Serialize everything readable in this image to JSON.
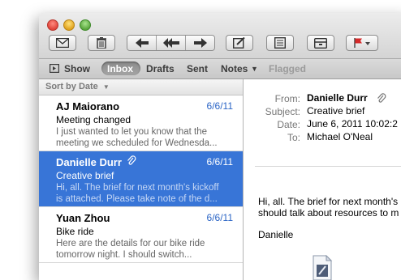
{
  "toolbar": {
    "buttons": [
      "compose-icon",
      "trash-icon",
      "reply-icon",
      "reply-all-icon",
      "forward-icon",
      "new-note-icon",
      "list-icon",
      "archive-icon",
      "flag-icon"
    ]
  },
  "favorites": {
    "show_label": "Show",
    "items": [
      {
        "label": "Inbox",
        "selected": true
      },
      {
        "label": "Drafts"
      },
      {
        "label": "Sent"
      },
      {
        "label": "Notes"
      },
      {
        "label": "Flagged",
        "disabled": true
      }
    ]
  },
  "list": {
    "sort_label": "Sort by Date",
    "messages": [
      {
        "from": "AJ Maiorano",
        "date": "6/6/11",
        "subject": "Meeting changed",
        "preview1": "I just wanted to let you know that the",
        "preview2": "meeting we scheduled for Wednesda..."
      },
      {
        "from": "Danielle Durr",
        "date": "6/6/11",
        "subject": "Creative brief",
        "preview1": "Hi, all. The brief for next month's kickoff",
        "preview2": "is attached. Please take note of the d...",
        "selected": true,
        "attachment": true
      },
      {
        "from": "Yuan Zhou",
        "date": "6/6/11",
        "subject": "Bike ride",
        "preview1": "Here are the details for our bike ride",
        "preview2": "tomorrow night. I should switch..."
      }
    ]
  },
  "reader": {
    "labels": {
      "from": "From:",
      "subject": "Subject:",
      "date": "Date:",
      "to": "To:"
    },
    "from": "Danielle Durr",
    "subject": "Creative brief",
    "date": "June 6, 2011 10:02:2",
    "to": "Michael O'Neal",
    "body1": "Hi, all. The brief for next month's kickoff",
    "body2": "should talk about resources to m",
    "signature": "Danielle"
  },
  "colors": {
    "selection": "#3875d7",
    "date_blue": "#2a64c5",
    "flag_red": "#d62a2a"
  }
}
